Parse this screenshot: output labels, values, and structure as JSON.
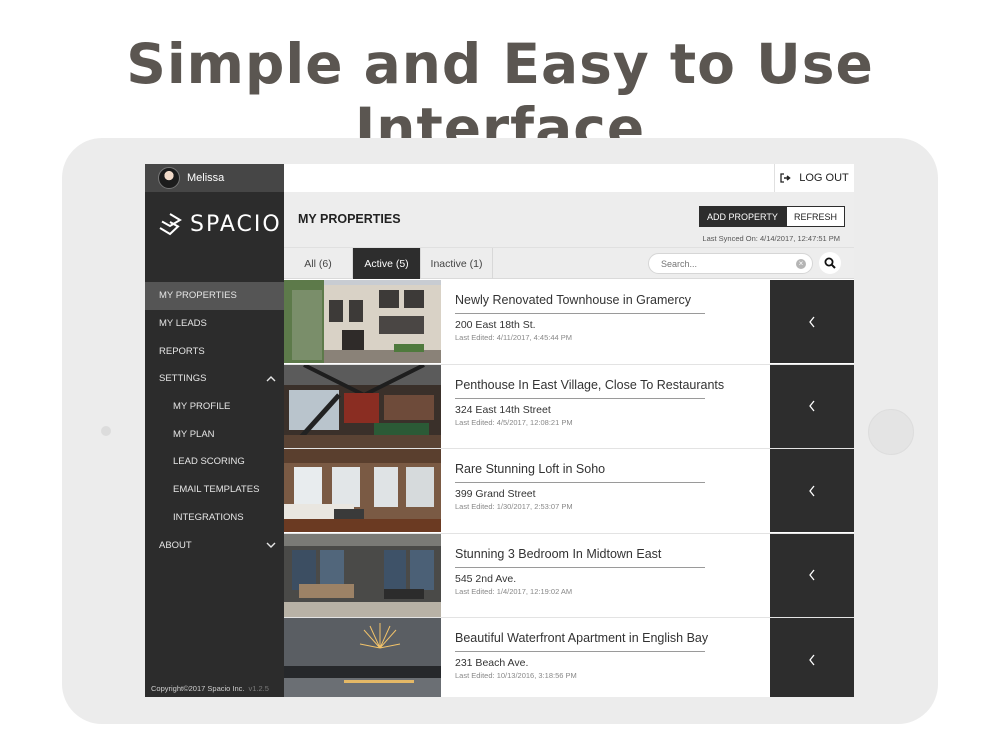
{
  "headline": "Simple and Easy to Use Interface",
  "user": {
    "name": "Melissa"
  },
  "brand": {
    "logo_text": "SPACIO"
  },
  "nav": {
    "items": [
      {
        "label": "MY PROPERTIES",
        "active": true
      },
      {
        "label": "MY LEADS"
      },
      {
        "label": "REPORTS"
      },
      {
        "label": "SETTINGS",
        "icon": "chevron-up-icon"
      },
      {
        "label": "MY PROFILE"
      },
      {
        "label": "MY PLAN"
      },
      {
        "label": "LEAD SCORING"
      },
      {
        "label": "EMAIL TEMPLATES"
      },
      {
        "label": "INTEGRATIONS"
      },
      {
        "label": "ABOUT",
        "icon": "chevron-down-icon"
      }
    ]
  },
  "footer": {
    "copyright": "Copyright©2017 Spacio Inc.",
    "version": "v1.2.5"
  },
  "topbar": {
    "logout_label": "LOG OUT"
  },
  "header": {
    "title": "MY PROPERTIES",
    "add_label": "ADD PROPERTY",
    "refresh_label": "REFRESH",
    "sync_text": "Last Synced On: 4/14/2017, 12:47:51 PM"
  },
  "tabs": [
    {
      "label": "All (6)"
    },
    {
      "label": "Active (5)",
      "active": true
    },
    {
      "label": "Inactive (1)"
    }
  ],
  "search": {
    "placeholder": "Search..."
  },
  "properties": [
    {
      "title": "Newly Renovated Townhouse in Gramercy",
      "address": "200 East 18th St.",
      "edited": "Last Edited: 4/11/2017, 4:45:44 PM"
    },
    {
      "title": "Penthouse In East Village, Close To Restaurants",
      "address": "324 East 14th Street",
      "edited": "Last Edited: 4/5/2017, 12:08:21 PM"
    },
    {
      "title": "Rare Stunning Loft in Soho",
      "address": "399 Grand Street",
      "edited": "Last Edited: 1/30/2017, 2:53:07 PM"
    },
    {
      "title": "Stunning 3 Bedroom In Midtown East",
      "address": "545 2nd Ave.",
      "edited": "Last Edited: 1/4/2017, 12:19:02 AM"
    },
    {
      "title": "Beautiful Waterfront Apartment in English Bay",
      "address": "231 Beach Ave.",
      "edited": "Last Edited: 10/13/2016, 3:18:56 PM"
    }
  ],
  "colors": {
    "sidebar": "#2c2c2c",
    "accent_dark": "#2d2d2d",
    "headline": "#5b5651"
  }
}
